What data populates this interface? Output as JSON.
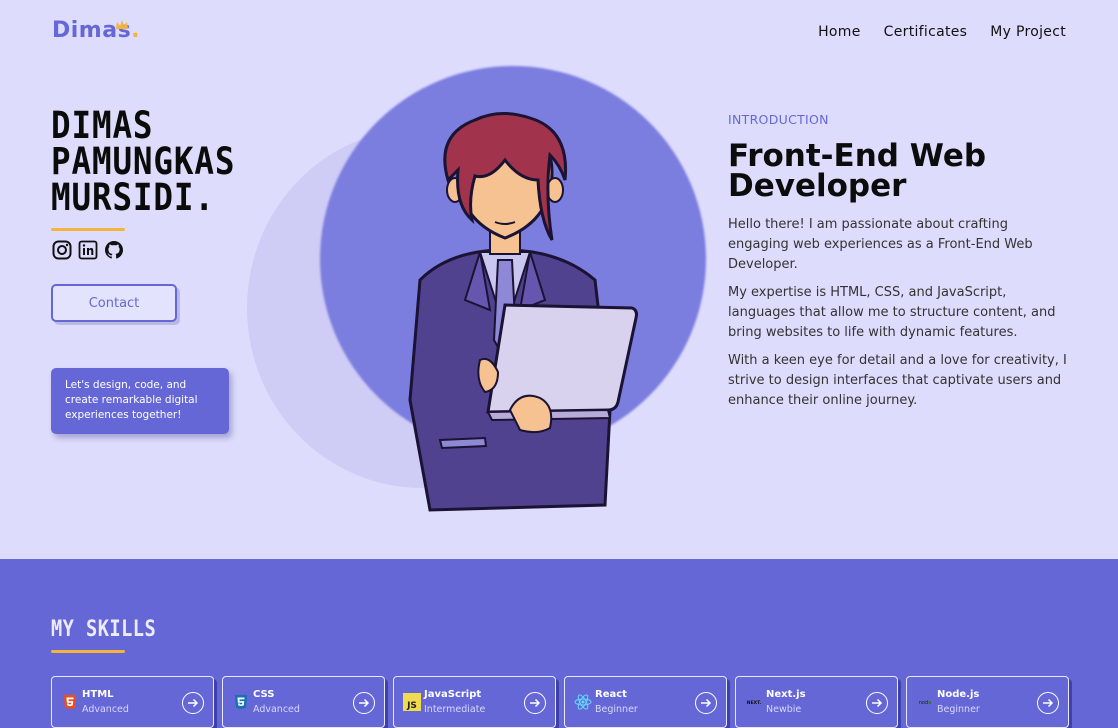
{
  "nav": {
    "logo_text": "Dimas",
    "logo_dot": ".",
    "items": [
      {
        "label": "Home"
      },
      {
        "label": "Certificates"
      },
      {
        "label": "My Project"
      }
    ]
  },
  "hero": {
    "name_lines": [
      "DIMAS",
      "PAMUNGKAS",
      "MURSIDI."
    ],
    "socials": [
      {
        "icon": "instagram-icon"
      },
      {
        "icon": "linkedin-icon"
      },
      {
        "icon": "github-icon"
      }
    ],
    "contact_label": "Contact",
    "tagline": "Let's design, code, and create remarkable digital experiences together!"
  },
  "intro": {
    "eyebrow": "INTRODUCTION",
    "headline": "Front-End Web Developer",
    "paragraphs": [
      "Hello there! I am passionate about crafting engaging web experiences as a Front-End Web Developer.",
      "My expertise is HTML, CSS, and JavaScript, languages that allow me to structure content, and bring websites to life with dynamic features.",
      "With a keen eye for detail and a love for creativity, I strive to design interfaces that captivate users and enhance their online journey."
    ]
  },
  "skills": {
    "title": "MY SKILLS",
    "items": [
      {
        "name": "HTML",
        "level": "Advanced",
        "icon": "html5-icon"
      },
      {
        "name": "CSS",
        "level": "Advanced",
        "icon": "css3-icon"
      },
      {
        "name": "JavaScript",
        "level": "Intermediate",
        "icon": "javascript-icon"
      },
      {
        "name": "React",
        "level": "Beginner",
        "icon": "react-icon"
      },
      {
        "name": "Next.js",
        "level": "Newbie",
        "icon": "nextjs-icon"
      },
      {
        "name": "Node.js",
        "level": "Beginner",
        "icon": "nodejs-icon"
      }
    ]
  },
  "colors": {
    "background": "#dddcfc",
    "accent": "#6667d6",
    "highlight": "#f4b43c"
  }
}
